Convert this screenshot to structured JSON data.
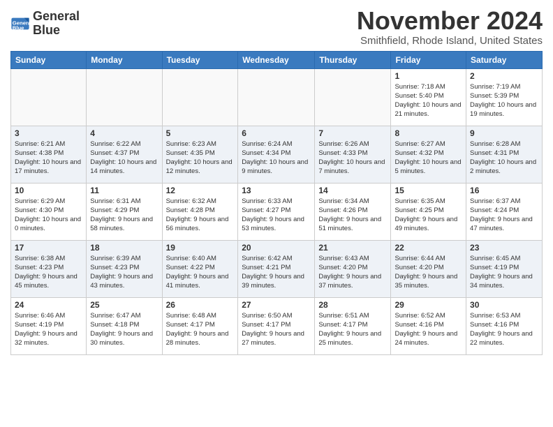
{
  "logo": {
    "line1": "General",
    "line2": "Blue"
  },
  "title": "November 2024",
  "subtitle": "Smithfield, Rhode Island, United States",
  "weekdays": [
    "Sunday",
    "Monday",
    "Tuesday",
    "Wednesday",
    "Thursday",
    "Friday",
    "Saturday"
  ],
  "weeks": [
    [
      {
        "day": "",
        "empty": true
      },
      {
        "day": "",
        "empty": true
      },
      {
        "day": "",
        "empty": true
      },
      {
        "day": "",
        "empty": true
      },
      {
        "day": "",
        "empty": true
      },
      {
        "day": "1",
        "sunrise": "Sunrise: 7:18 AM",
        "sunset": "Sunset: 5:40 PM",
        "daylight": "Daylight: 10 hours and 21 minutes."
      },
      {
        "day": "2",
        "sunrise": "Sunrise: 7:19 AM",
        "sunset": "Sunset: 5:39 PM",
        "daylight": "Daylight: 10 hours and 19 minutes."
      }
    ],
    [
      {
        "day": "3",
        "sunrise": "Sunrise: 6:21 AM",
        "sunset": "Sunset: 4:38 PM",
        "daylight": "Daylight: 10 hours and 17 minutes."
      },
      {
        "day": "4",
        "sunrise": "Sunrise: 6:22 AM",
        "sunset": "Sunset: 4:37 PM",
        "daylight": "Daylight: 10 hours and 14 minutes."
      },
      {
        "day": "5",
        "sunrise": "Sunrise: 6:23 AM",
        "sunset": "Sunset: 4:35 PM",
        "daylight": "Daylight: 10 hours and 12 minutes."
      },
      {
        "day": "6",
        "sunrise": "Sunrise: 6:24 AM",
        "sunset": "Sunset: 4:34 PM",
        "daylight": "Daylight: 10 hours and 9 minutes."
      },
      {
        "day": "7",
        "sunrise": "Sunrise: 6:26 AM",
        "sunset": "Sunset: 4:33 PM",
        "daylight": "Daylight: 10 hours and 7 minutes."
      },
      {
        "day": "8",
        "sunrise": "Sunrise: 6:27 AM",
        "sunset": "Sunset: 4:32 PM",
        "daylight": "Daylight: 10 hours and 5 minutes."
      },
      {
        "day": "9",
        "sunrise": "Sunrise: 6:28 AM",
        "sunset": "Sunset: 4:31 PM",
        "daylight": "Daylight: 10 hours and 2 minutes."
      }
    ],
    [
      {
        "day": "10",
        "sunrise": "Sunrise: 6:29 AM",
        "sunset": "Sunset: 4:30 PM",
        "daylight": "Daylight: 10 hours and 0 minutes."
      },
      {
        "day": "11",
        "sunrise": "Sunrise: 6:31 AM",
        "sunset": "Sunset: 4:29 PM",
        "daylight": "Daylight: 9 hours and 58 minutes."
      },
      {
        "day": "12",
        "sunrise": "Sunrise: 6:32 AM",
        "sunset": "Sunset: 4:28 PM",
        "daylight": "Daylight: 9 hours and 56 minutes."
      },
      {
        "day": "13",
        "sunrise": "Sunrise: 6:33 AM",
        "sunset": "Sunset: 4:27 PM",
        "daylight": "Daylight: 9 hours and 53 minutes."
      },
      {
        "day": "14",
        "sunrise": "Sunrise: 6:34 AM",
        "sunset": "Sunset: 4:26 PM",
        "daylight": "Daylight: 9 hours and 51 minutes."
      },
      {
        "day": "15",
        "sunrise": "Sunrise: 6:35 AM",
        "sunset": "Sunset: 4:25 PM",
        "daylight": "Daylight: 9 hours and 49 minutes."
      },
      {
        "day": "16",
        "sunrise": "Sunrise: 6:37 AM",
        "sunset": "Sunset: 4:24 PM",
        "daylight": "Daylight: 9 hours and 47 minutes."
      }
    ],
    [
      {
        "day": "17",
        "sunrise": "Sunrise: 6:38 AM",
        "sunset": "Sunset: 4:23 PM",
        "daylight": "Daylight: 9 hours and 45 minutes."
      },
      {
        "day": "18",
        "sunrise": "Sunrise: 6:39 AM",
        "sunset": "Sunset: 4:23 PM",
        "daylight": "Daylight: 9 hours and 43 minutes."
      },
      {
        "day": "19",
        "sunrise": "Sunrise: 6:40 AM",
        "sunset": "Sunset: 4:22 PM",
        "daylight": "Daylight: 9 hours and 41 minutes."
      },
      {
        "day": "20",
        "sunrise": "Sunrise: 6:42 AM",
        "sunset": "Sunset: 4:21 PM",
        "daylight": "Daylight: 9 hours and 39 minutes."
      },
      {
        "day": "21",
        "sunrise": "Sunrise: 6:43 AM",
        "sunset": "Sunset: 4:20 PM",
        "daylight": "Daylight: 9 hours and 37 minutes."
      },
      {
        "day": "22",
        "sunrise": "Sunrise: 6:44 AM",
        "sunset": "Sunset: 4:20 PM",
        "daylight": "Daylight: 9 hours and 35 minutes."
      },
      {
        "day": "23",
        "sunrise": "Sunrise: 6:45 AM",
        "sunset": "Sunset: 4:19 PM",
        "daylight": "Daylight: 9 hours and 34 minutes."
      }
    ],
    [
      {
        "day": "24",
        "sunrise": "Sunrise: 6:46 AM",
        "sunset": "Sunset: 4:19 PM",
        "daylight": "Daylight: 9 hours and 32 minutes."
      },
      {
        "day": "25",
        "sunrise": "Sunrise: 6:47 AM",
        "sunset": "Sunset: 4:18 PM",
        "daylight": "Daylight: 9 hours and 30 minutes."
      },
      {
        "day": "26",
        "sunrise": "Sunrise: 6:48 AM",
        "sunset": "Sunset: 4:17 PM",
        "daylight": "Daylight: 9 hours and 28 minutes."
      },
      {
        "day": "27",
        "sunrise": "Sunrise: 6:50 AM",
        "sunset": "Sunset: 4:17 PM",
        "daylight": "Daylight: 9 hours and 27 minutes."
      },
      {
        "day": "28",
        "sunrise": "Sunrise: 6:51 AM",
        "sunset": "Sunset: 4:17 PM",
        "daylight": "Daylight: 9 hours and 25 minutes."
      },
      {
        "day": "29",
        "sunrise": "Sunrise: 6:52 AM",
        "sunset": "Sunset: 4:16 PM",
        "daylight": "Daylight: 9 hours and 24 minutes."
      },
      {
        "day": "30",
        "sunrise": "Sunrise: 6:53 AM",
        "sunset": "Sunset: 4:16 PM",
        "daylight": "Daylight: 9 hours and 22 minutes."
      }
    ]
  ]
}
